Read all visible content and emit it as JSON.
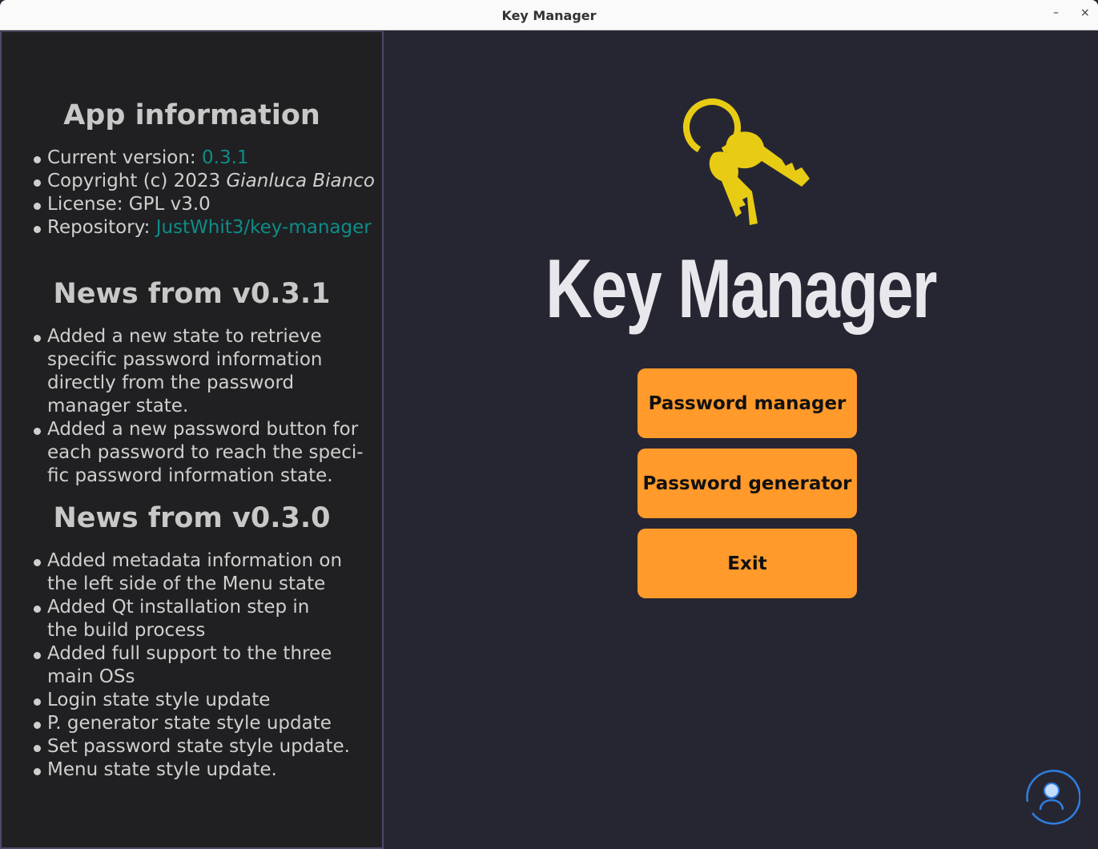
{
  "window": {
    "title": "Key Manager",
    "minimize": "–",
    "close": "×"
  },
  "sidebar": {
    "app_info": {
      "heading": "App information",
      "version_label": "Current version: ",
      "version": "0.3.1",
      "copyright_label": "Copyright (c) 2023 ",
      "author": "Gianluca Bianco",
      "license": "License: GPL v3.0",
      "repo_label": "Repository: ",
      "repo": "JustWhit3/key-manager"
    },
    "news_031": {
      "heading": "News from v0.3.1",
      "items": [
        "Added a new state to retrieve speci­fic password information directly from the password manager state.",
        "Added a new password button for each password to reach the speci­fic password information state."
      ]
    },
    "news_030": {
      "heading": "News from v0.3.0",
      "items": [
        "Added metadata information on the left side of the Menu state",
        "Added Qt installation step in the build process",
        "Added full support to the three main OSs",
        "Login state style update",
        "P. generator state style update",
        "Set password state style update.",
        "Menu state style update."
      ]
    }
  },
  "main": {
    "title": "Key Manager",
    "buttons": [
      "Password manager",
      "Password generator",
      "Exit"
    ],
    "colors": {
      "button": "#ff9a2b",
      "logo": "#e8cc14",
      "accent": "#2f7fe0"
    }
  }
}
